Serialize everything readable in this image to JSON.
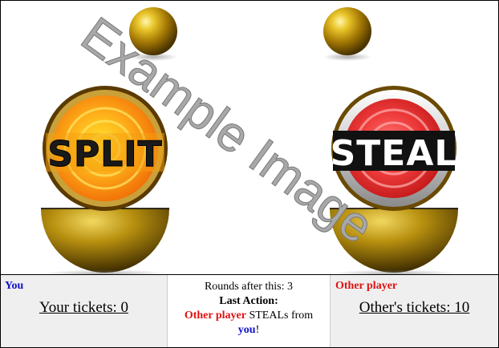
{
  "watermark": "Example Image",
  "badges": {
    "left": "SPLIT",
    "right": "STEAL"
  },
  "colors": {
    "you": "#1010cc",
    "other": "#e01010"
  },
  "footer": {
    "you_label": "You",
    "your_tickets": "Your tickets: 0",
    "rounds": "Rounds after this: 3",
    "last_action_label": "Last Action:",
    "action_actor": "Other player",
    "action_verb": " STEALs from ",
    "action_target": "you",
    "action_end": "!",
    "other_label": "Other player",
    "other_tickets": "Other's tickets: 10"
  }
}
